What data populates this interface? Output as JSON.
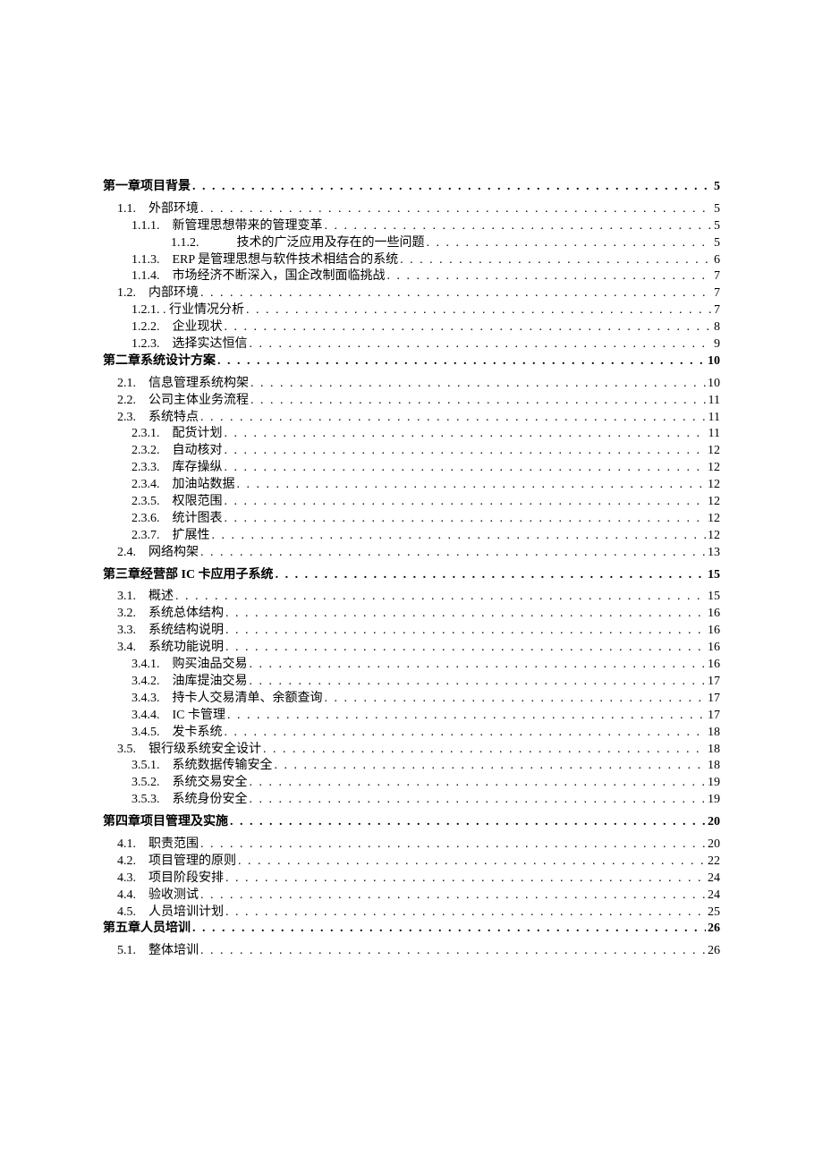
{
  "toc": [
    {
      "level": 0,
      "label": "第一章项目背景",
      "page": "5"
    },
    {
      "level": 1,
      "label": "1.1.　外部环境",
      "page": "5",
      "sp": true
    },
    {
      "level": 2,
      "label": "1.1.1.　新管理思想带来的管理变革",
      "page": "5"
    },
    {
      "level": "2c",
      "label": "1.1.2.　　　技术的广泛应用及存在的一些问题",
      "page": "5"
    },
    {
      "level": 2,
      "label": "1.1.3.　ERP 是管理思想与软件技术相结合的系统",
      "page": "6"
    },
    {
      "level": 2,
      "label": "1.1.4.　市场经济不断深入，国企改制面临挑战",
      "page": "7"
    },
    {
      "level": 1,
      "label": "1.2.　内部环境",
      "page": "7"
    },
    {
      "level": 2,
      "label": "1.2.1. . 行业情况分析",
      "page": "7"
    },
    {
      "level": 2,
      "label": "1.2.2.　企业现状",
      "page": "8"
    },
    {
      "level": 2,
      "label": "1.2.3.　选择实达恒信",
      "page": "9"
    },
    {
      "level": 0,
      "label": "第二章系统设计方案",
      "page": "10"
    },
    {
      "level": 1,
      "label": "2.1.　信息管理系统构架",
      "page": "10",
      "sp": true
    },
    {
      "level": 1,
      "label": "2.2.　公司主体业务流程",
      "page": "11"
    },
    {
      "level": 1,
      "label": "2.3.　系统特点",
      "page": "11"
    },
    {
      "level": 2,
      "label": "2.3.1.　配货计划",
      "page": "11"
    },
    {
      "level": 2,
      "label": "2.3.2.　自动核对",
      "page": "12"
    },
    {
      "level": 2,
      "label": "2.3.3.　库存操纵",
      "page": "12"
    },
    {
      "level": 2,
      "label": "2.3.4.　加油站数据",
      "page": "12"
    },
    {
      "level": 2,
      "label": "2.3.5.　权限范围",
      "page": "12"
    },
    {
      "level": 2,
      "label": "2.3.6.　统计图表",
      "page": "12"
    },
    {
      "level": 2,
      "label": "2.3.7.　扩展性",
      "page": "12"
    },
    {
      "level": 1,
      "label": "2.4.　网络构架",
      "page": "13"
    },
    {
      "level": 0,
      "label": "第三章经营部 IC 卡应用子系统",
      "page": "15",
      "sp": true
    },
    {
      "level": 1,
      "label": "3.1.　概述",
      "page": "15",
      "sp": true
    },
    {
      "level": 1,
      "label": "3.2.　系统总体结构",
      "page": "16"
    },
    {
      "level": 1,
      "label": "3.3.　系统结构说明",
      "page": "16"
    },
    {
      "level": 1,
      "label": "3.4.　系统功能说明",
      "page": "16"
    },
    {
      "level": 2,
      "label": "3.4.1.　购买油品交易",
      "page": "16"
    },
    {
      "level": 2,
      "label": "3.4.2.　油库提油交易",
      "page": "17"
    },
    {
      "level": 2,
      "label": "3.4.3.　持卡人交易清单、余额查询",
      "page": "17"
    },
    {
      "level": 2,
      "label": "3.4.4.　IC 卡管理",
      "page": "17"
    },
    {
      "level": 2,
      "label": "3.4.5.　发卡系统",
      "page": "18"
    },
    {
      "level": 1,
      "label": "3.5.　银行级系统安全设计",
      "page": "18"
    },
    {
      "level": 2,
      "label": "3.5.1.　系统数据传输安全",
      "page": "18"
    },
    {
      "level": 2,
      "label": "3.5.2.　系统交易安全",
      "page": "19"
    },
    {
      "level": 2,
      "label": "3.5.3.　系统身份安全",
      "page": "19"
    },
    {
      "level": 0,
      "label": "第四章项目管理及实施",
      "page": "20",
      "sp": true
    },
    {
      "level": 1,
      "label": "4.1.　职责范围",
      "page": "20",
      "sp": true
    },
    {
      "level": 1,
      "label": "4.2.　项目管理的原则",
      "page": "22"
    },
    {
      "level": 1,
      "label": "4.3.　项目阶段安排",
      "page": "24"
    },
    {
      "level": 1,
      "label": "4.4.　验收测试",
      "page": "24"
    },
    {
      "level": 1,
      "label": "4.5.　人员培训计划",
      "page": "25"
    },
    {
      "level": 0,
      "label": "第五章人员培训",
      "page": "26"
    },
    {
      "level": 1,
      "label": "5.1.　整体培训",
      "page": "26",
      "sp": true
    }
  ]
}
